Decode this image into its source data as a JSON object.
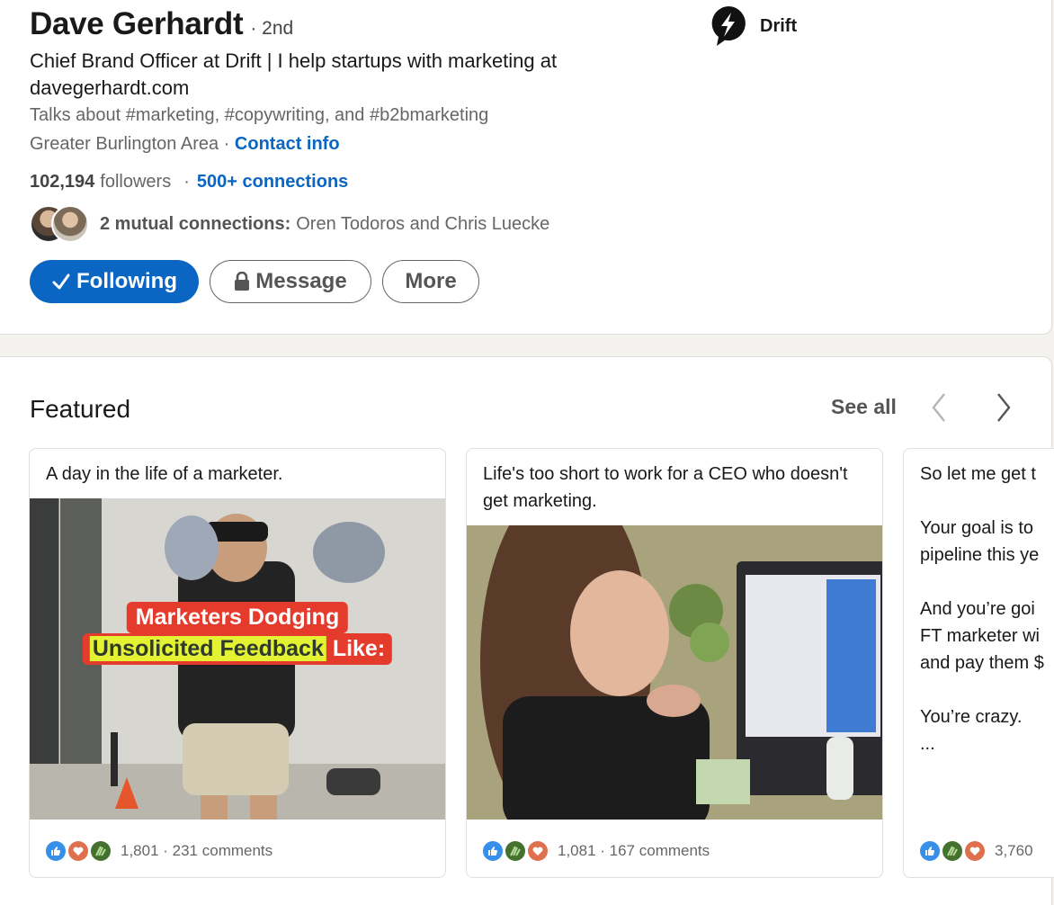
{
  "profile": {
    "name": "Dave Gerhardt",
    "degree": "· 2nd",
    "headline": "Chief Brand Officer at Drift | I help startups with marketing at davegerhardt.com",
    "talks_about": "Talks about #marketing, #copywriting, and #b2bmarketing",
    "location": "Greater Burlington Area",
    "location_sep": " · ",
    "contact_info": "Contact info",
    "followers_count": "102,194",
    "followers_label": "followers",
    "connections_sep": "·",
    "connections": "500+ connections",
    "mutual_label": "2 mutual connections:",
    "mutual_names": "Oren Todoros and Chris Luecke",
    "company": "Drift"
  },
  "actions": {
    "following": "Following",
    "message": "Message",
    "more": "More"
  },
  "featured": {
    "title": "Featured",
    "see_all": "See all",
    "items": [
      {
        "caption": "A day in the life of a marketer.",
        "overlay_line1": "Marketers Dodging",
        "overlay_highlight": "Unsolicited Feedback",
        "overlay_rest": " Like:",
        "reactions": [
          "like",
          "love",
          "support"
        ],
        "stats": "1,801 · 231 comments"
      },
      {
        "caption": "Life's too short to work for a CEO who doesn't get marketing.",
        "reactions": [
          "like",
          "support",
          "love"
        ],
        "stats": "1,081 · 167 comments"
      },
      {
        "caption": "So let me get t\n\nYour goal is to\npipeline this ye\n\nAnd you’re goi\nFT marketer wi\nand pay them $\n\nYou’re crazy.\n...",
        "reactions": [
          "like",
          "support",
          "love"
        ],
        "stats": "3,760"
      }
    ]
  },
  "colors": {
    "brand_blue": "#0a66c2",
    "like": "#378fe9",
    "love": "#df704d",
    "support": "#44712e"
  }
}
